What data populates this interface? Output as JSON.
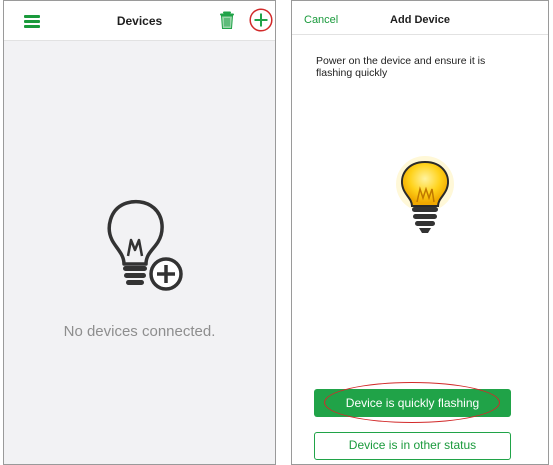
{
  "left_screen": {
    "title": "Devices",
    "menu_icon": "hamburger-icon",
    "delete_icon": "trash-icon",
    "add_icon": "plus-icon",
    "empty_icon": "lightbulb-plus-icon",
    "empty_text": "No devices connected."
  },
  "right_screen": {
    "cancel_label": "Cancel",
    "title": "Add Device",
    "instruction": "Power on the device and ensure it is flashing quickly",
    "bulb_icon": "lit-lightbulb-icon",
    "primary_button": "Device is quickly flashing",
    "secondary_button": "Device is in other status"
  },
  "colors": {
    "accent": "#20a348",
    "highlight_circle": "#d22a2a",
    "bulb_glow": "#f5c400",
    "left_background": "#f2f2f4"
  }
}
